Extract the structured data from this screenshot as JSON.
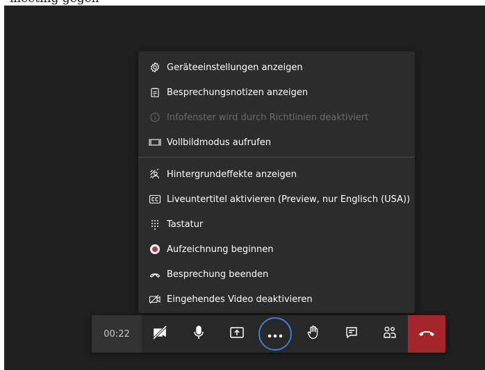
{
  "caption": "meeting gegen",
  "menu": {
    "items": [
      {
        "label": "Geräteeinstellungen anzeigen",
        "icon": "gear-icon"
      },
      {
        "label": "Besprechungsnotizen anzeigen",
        "icon": "notes-icon"
      },
      {
        "label": "Infofenster wird durch Richtlinien deaktiviert",
        "icon": "info-icon",
        "disabled": true
      },
      {
        "label": "Vollbildmodus aufrufen",
        "icon": "fullscreen-icon"
      },
      {
        "label": "Hintergrundeffekte anzeigen",
        "icon": "background-effects-icon"
      },
      {
        "label": "Liveuntertitel aktivieren (Preview, nur Englisch (USA))",
        "icon": "closed-captions-icon"
      },
      {
        "label": "Tastatur",
        "icon": "keypad-icon"
      },
      {
        "label": "Aufzeichnung beginnen",
        "icon": "record-icon"
      },
      {
        "label": "Besprechung beenden",
        "icon": "end-call-icon"
      },
      {
        "label": "Eingehendes Video deaktivieren",
        "icon": "video-off-icon"
      }
    ]
  },
  "toolbar": {
    "timer": "00:22",
    "buttons": [
      "camera-off-icon",
      "microphone-icon",
      "share-screen-icon",
      "more-options-icon",
      "raise-hand-icon",
      "chat-icon",
      "participants-icon",
      "hang-up-icon"
    ]
  },
  "colors": {
    "accent": "#3a7bd5",
    "leave": "#a4262c",
    "record": "#c4314b"
  }
}
